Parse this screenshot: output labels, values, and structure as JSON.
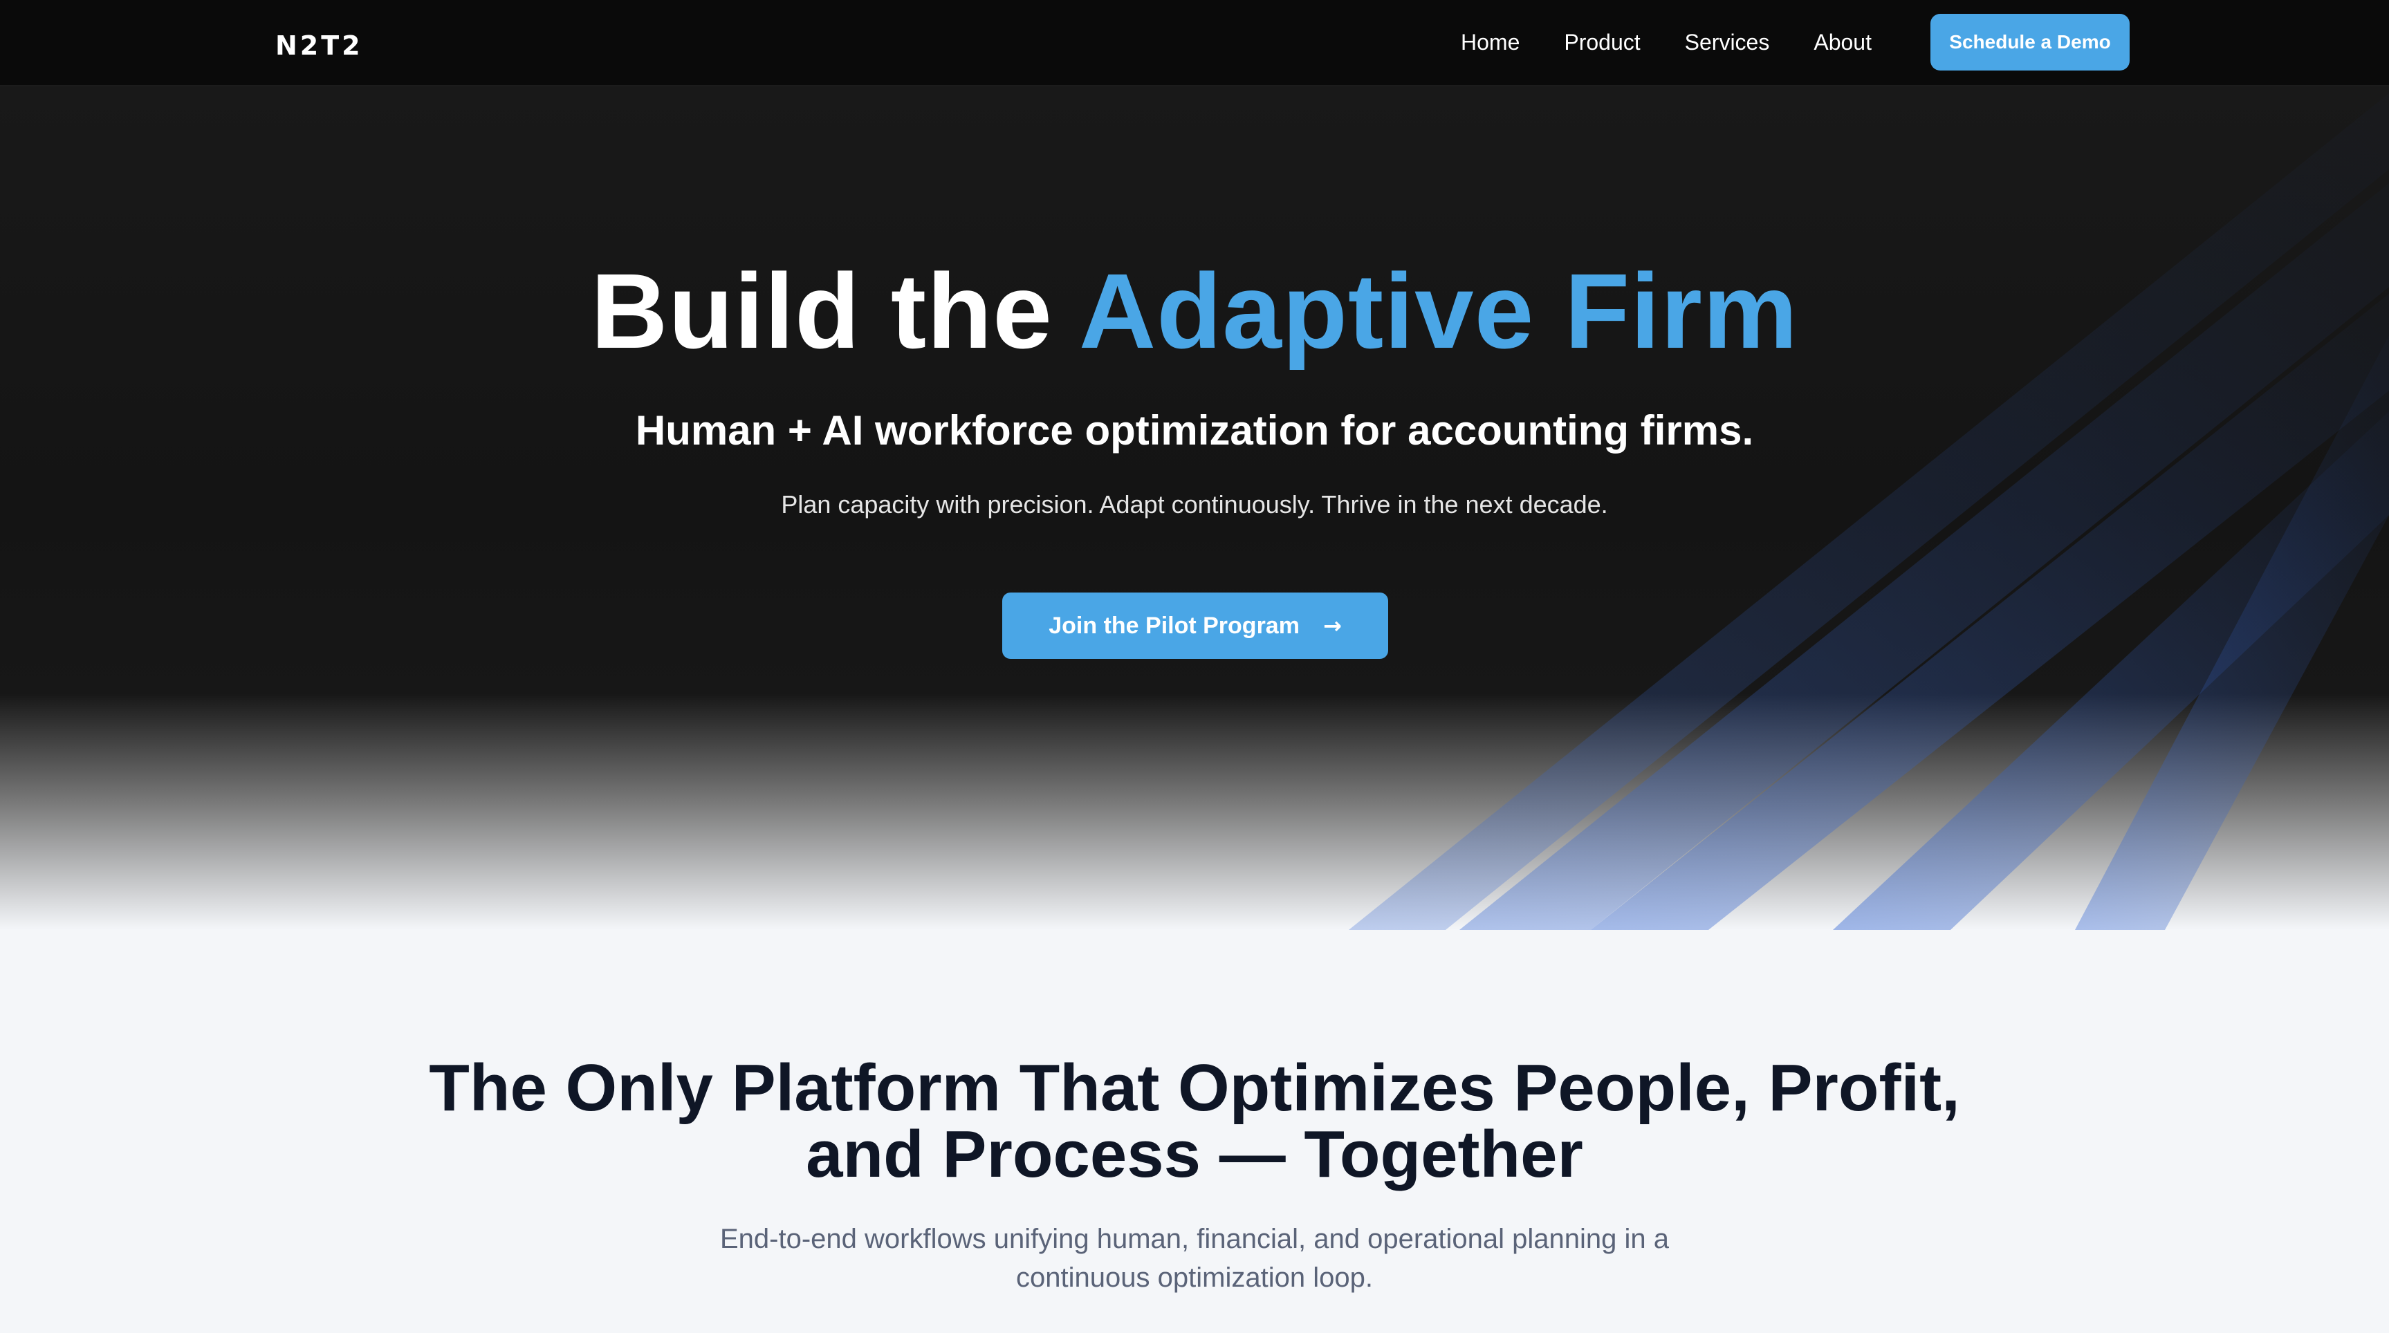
{
  "nav": {
    "logo": "N2T2",
    "links": [
      "Home",
      "Product",
      "Services",
      "About"
    ],
    "cta": "Schedule a Demo"
  },
  "hero": {
    "title_main": "Build the ",
    "title_accent": "Adaptive Firm",
    "subtitle": "Human + AI workforce optimization for accounting firms.",
    "tagline": "Plan capacity with precision. Adapt continuously. Thrive in the next decade.",
    "cta": "Join the Pilot Program",
    "cta_icon": "arrow-right-icon"
  },
  "section2": {
    "title_line1": "The Only Platform That Optimizes People, Profit,",
    "title_line2": "and Process — Together",
    "description": "End-to-end workflows unifying human, financial, and operational planning in a continuous optimization loop."
  },
  "colors": {
    "accent": "#4aa6e6",
    "nav_bg": "#0a0a0a",
    "hero_bg": "#171717",
    "section_bg": "#f4f6f9",
    "heading_dark": "#0f1626",
    "body_muted": "#5a6378"
  }
}
